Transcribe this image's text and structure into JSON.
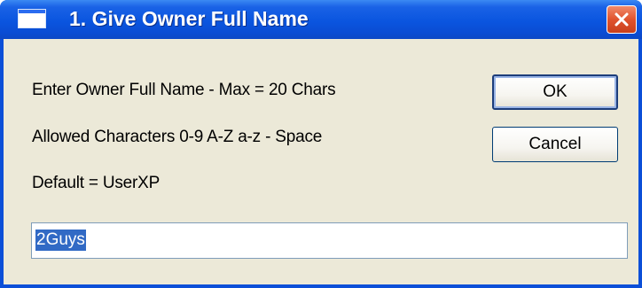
{
  "window": {
    "title": "1. Give Owner Full Name",
    "colors": {
      "titlebar": "#0a55df",
      "close": "#e0532e",
      "client": "#ece9d8",
      "selection": "#316ac5"
    }
  },
  "labels": {
    "line1": "Enter Owner Full Name - Max = 20 Chars",
    "line2": "Allowed Characters 0-9 A-Z a-z - Space",
    "line3": "Default = UserXP"
  },
  "buttons": {
    "ok": "OK",
    "cancel": "Cancel"
  },
  "input": {
    "value": "2Guys"
  },
  "icons": {
    "window": "window-icon",
    "close": "close-icon"
  }
}
